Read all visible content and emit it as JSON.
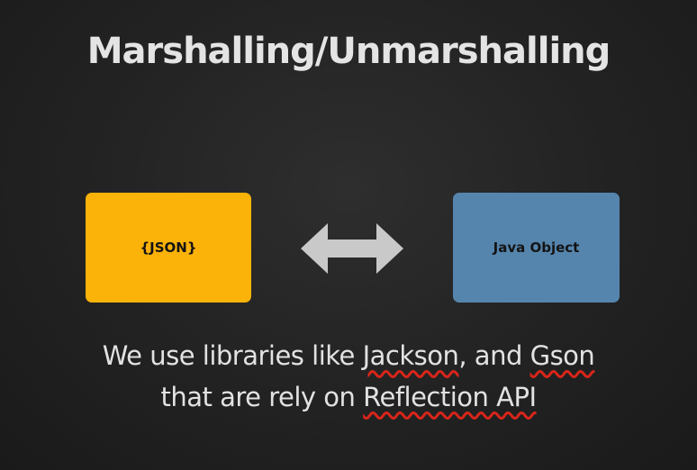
{
  "slide": {
    "title": "Marshalling/Unmarshalling",
    "left_box": {
      "label": "{JSON}",
      "color": "#fbb209"
    },
    "right_box": {
      "label": "Java Object",
      "color": "#5585ad"
    },
    "arrow": {
      "icon": "double-headed-arrow-icon",
      "color": "#c9c9c9"
    },
    "caption": {
      "line1_pre": "We use libraries like ",
      "jackson": "Jackson",
      "line1_mid": ", and ",
      "gson": "Gson",
      "line2_pre": "that are rely on ",
      "reflection": "Reflection API",
      "underline_color": "#d9251a"
    }
  }
}
